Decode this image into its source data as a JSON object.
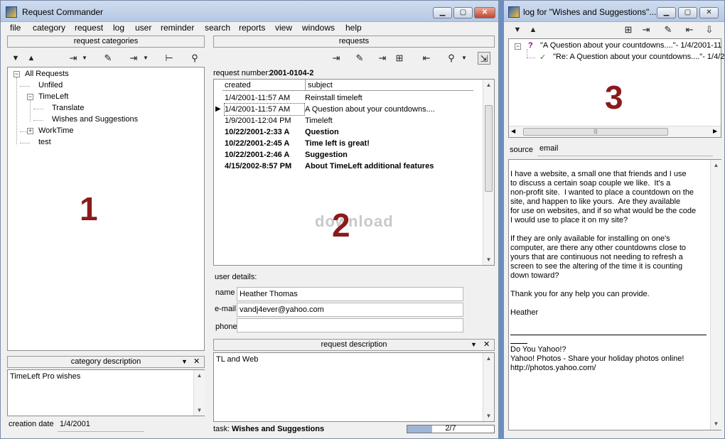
{
  "main_window": {
    "title": "Request Commander",
    "controls": {
      "minimize": "▁",
      "maximize": "▢",
      "close": "✕"
    },
    "menu": [
      "file",
      "category",
      "request",
      "log",
      "user",
      "reminder",
      "search",
      "reports",
      "view",
      "windows",
      "help"
    ]
  },
  "categories": {
    "caption": "request categories",
    "toolbar_icons": [
      "expand-down-icon",
      "collapse-up-icon",
      "new-category-icon",
      "edit-category-icon",
      "move-category-icon",
      "tree-icon",
      "search-icon"
    ],
    "tree": [
      {
        "label": "All Requests",
        "expander": "−"
      },
      {
        "label": "Unfiled"
      },
      {
        "label": "TimeLeft",
        "expander": "−"
      },
      {
        "label": "Translate"
      },
      {
        "label": "Wishes and Suggestions"
      },
      {
        "label": "WorkTime",
        "expander": "+"
      },
      {
        "label": "test"
      }
    ],
    "panel_number": "1"
  },
  "category_description": {
    "caption": "category description",
    "dropdown": "▼",
    "close": "✕",
    "text": "TimeLeft Pro wishes",
    "creation_label": "creation date",
    "creation_value": "1/4/2001"
  },
  "requests": {
    "caption": "requests",
    "number_label": "request number:",
    "number_value": "2001-0104-2",
    "columns": [
      "created",
      "subject"
    ],
    "rows": [
      {
        "created": "1/4/2001-11:57 AM",
        "subject": "Reinstall timeleft",
        "bold": false,
        "current": false
      },
      {
        "created": "1/4/2001-11:57 AM",
        "subject": "A Question about your countdowns....",
        "bold": false,
        "current": true
      },
      {
        "created": "1/9/2001-12:04 PM",
        "subject": "Timeleft",
        "bold": false,
        "current": false
      },
      {
        "created": "10/22/2001-2:33 A",
        "subject": "Question",
        "bold": true,
        "current": false
      },
      {
        "created": "10/22/2001-2:45 A",
        "subject": "Time left is great!",
        "bold": true,
        "current": false
      },
      {
        "created": "10/22/2001-2:46 A",
        "subject": "Suggestion",
        "bold": true,
        "current": false
      },
      {
        "created": "4/15/2002-8:57 PM",
        "subject": "About TimeLeft additional features",
        "bold": true,
        "current": false
      }
    ],
    "watermark": "download",
    "panel_number": "2"
  },
  "user_details": {
    "label": "user details:",
    "name_label": "name",
    "name_value": "Heather Thomas",
    "email_label": "e-mail",
    "email_value": "vandj4ever@yahoo.com",
    "phone_label": "phone",
    "phone_value": ""
  },
  "request_description": {
    "caption": "request description",
    "dropdown": "▼",
    "close": "✕",
    "text": "TL and Web",
    "task_label": "task:",
    "task_value": "Wishes and Suggestions",
    "progress_text": "2/7",
    "progress_fraction": 0.286
  },
  "log_window": {
    "title": "log for \"Wishes and Suggestions\"...",
    "tree": [
      {
        "marker": "?",
        "label": "\"A Question about your countdowns....\"- 1/4/2001-11"
      },
      {
        "marker": "✓",
        "label": "\"Re: A Question about your countdowns....\"- 1/4/20"
      }
    ],
    "panel_number": "3",
    "source_label": "source",
    "source_value": "email",
    "message_lines": [
      "I have a website, a small one that friends and I use",
      "to discuss a certain soap couple we like.  It's a",
      "non-profit site.  I wanted to place a countdown on the",
      "site, and happen to like yours.  Are they available",
      "for use on websites, and if so what would be the code",
      "I would use to place it on my site?",
      "",
      "If they are only available for installing on one's",
      "computer, are there any other countdowns close to",
      "yours that are continuous not needing to refresh a",
      "screen to see the altering of the time it is counting",
      "down toward?",
      "",
      "Thank you for any help you can provide.",
      "",
      "Heather"
    ],
    "signature_lines": [
      "Do You Yahoo!?",
      "Yahoo! Photos - Share your holiday photos online!",
      "http://photos.yahoo.com/"
    ]
  }
}
